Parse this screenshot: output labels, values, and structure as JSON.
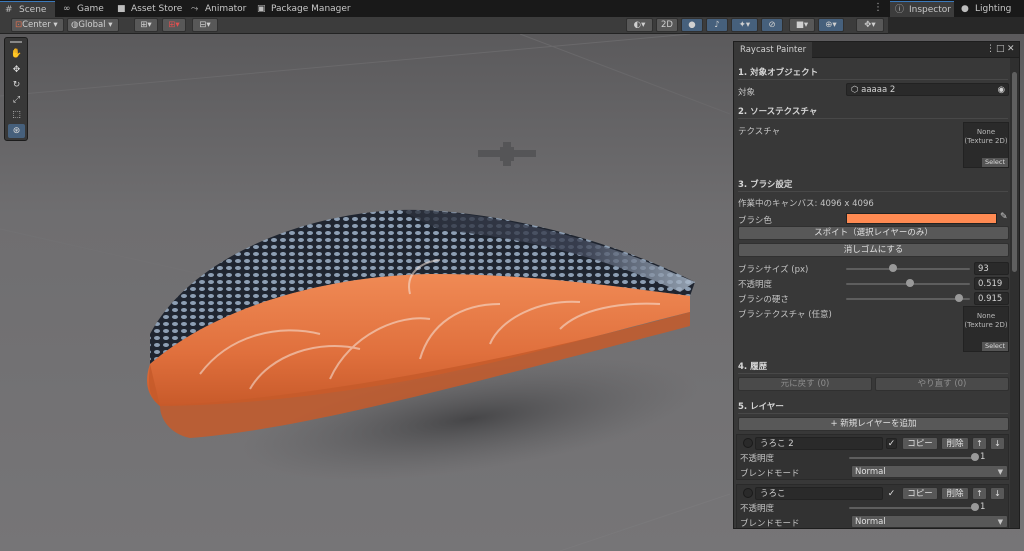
{
  "tabs": [
    {
      "label": "Scene",
      "icon": "scene-grid-icon",
      "glyph": "#"
    },
    {
      "label": "Game",
      "icon": "gamepad-icon",
      "glyph": "∞"
    },
    {
      "label": "Asset Store",
      "icon": "store-icon",
      "glyph": "■"
    },
    {
      "label": "Animator",
      "icon": "animator-icon",
      "glyph": "⤳"
    },
    {
      "label": "Package Manager",
      "icon": "package-icon",
      "glyph": "▣"
    }
  ],
  "right_tabs": [
    {
      "label": "Inspector",
      "icon": "info-icon",
      "glyph": "ⓘ"
    },
    {
      "label": "Lighting",
      "icon": "bulb-icon",
      "glyph": "●"
    }
  ],
  "toolbar": {
    "pivot_label": "Center",
    "space_label": "Global",
    "mode_2d": "2D"
  },
  "panel": {
    "title": "Raycast Painter",
    "sections": {
      "target": "1. 対象オブジェクト",
      "source": "2. ソーステクスチャ",
      "brush": "3. ブラシ設定",
      "history": "4. 履歴",
      "layers": "5. レイヤー"
    },
    "target_label": "対象",
    "target_value": "aaaaa 2",
    "texture_label": "テクスチャ",
    "texture_none_1": "None",
    "texture_none_2": "(Texture 2D)",
    "select_label": "Select",
    "canvas_info": "作業中のキャンバス: 4096 x 4096",
    "brush_color_label": "ブラシ色",
    "brush_color": "#ff8a52",
    "eyedropper_button": "スポイト（選択レイヤーのみ）",
    "eraser_button": "消しゴムにする",
    "brush_size_label": "ブラシサイズ (px)",
    "brush_size": "93",
    "brush_size_frac": 0.38,
    "opacity_label": "不透明度",
    "opacity": "0.519",
    "opacity_frac": 0.519,
    "hardness_label": "ブラシの硬さ",
    "hardness": "0.915",
    "hardness_frac": 0.915,
    "brush_texture_label": "ブラシテクスチャ (任意)",
    "undo_button": "元に戻す (0)",
    "redo_button": "やり直す (0)",
    "add_layer_button": "+ 新規レイヤーを追加",
    "layers": [
      {
        "name": "うろこ 2",
        "copy": "コピー",
        "delete": "削除",
        "up": "↑",
        "down": "↓",
        "opacity_label": "不透明度",
        "opacity": "1",
        "opacity_frac": 1.0,
        "blend_label": "ブレンドモード",
        "blend": "Normal"
      },
      {
        "name": "うろこ",
        "copy": "コピー",
        "delete": "削除",
        "up": "↑",
        "down": "↓",
        "opacity_label": "不透明度",
        "opacity": "1",
        "opacity_frac": 1.0,
        "blend_label": "ブレンドモード",
        "blend": "Normal"
      }
    ]
  }
}
